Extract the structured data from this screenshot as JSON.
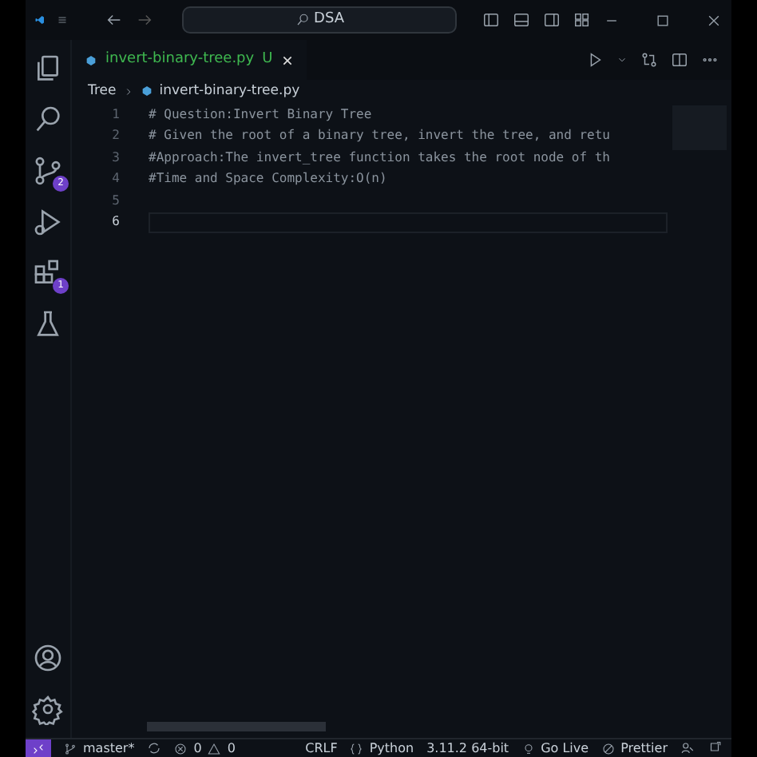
{
  "title_bar": {
    "search": "DSA"
  },
  "activity_bar": {
    "source_control_badge": "2",
    "extensions_badge": "1"
  },
  "tabs": [
    {
      "label": "invert-binary-tree.py",
      "status": "U",
      "selected": true
    }
  ],
  "breadcrumb": [
    "Tree",
    "invert-binary-tree.py"
  ],
  "editor": {
    "lines": [
      {
        "number": "1",
        "text": "# Question:Invert Binary Tree",
        "current": false
      },
      {
        "number": "2",
        "text": "# Given the root of a binary tree, invert the tree, and retu",
        "current": false
      },
      {
        "number": "3",
        "text": "#Approach:The invert_tree function takes the root node of th",
        "current": false
      },
      {
        "number": "4",
        "text": "#Time and Space Complexity:O(n)",
        "current": false
      },
      {
        "number": "5",
        "current": false
      },
      {
        "number": "6",
        "current": true
      }
    ]
  },
  "status_bar": {
    "branch": "master*",
    "problems": "0",
    "warnings": "0",
    "items": [
      "CRLF",
      "Python",
      "3.11.2 64-bit",
      "Go Live",
      "Prettier"
    ]
  }
}
